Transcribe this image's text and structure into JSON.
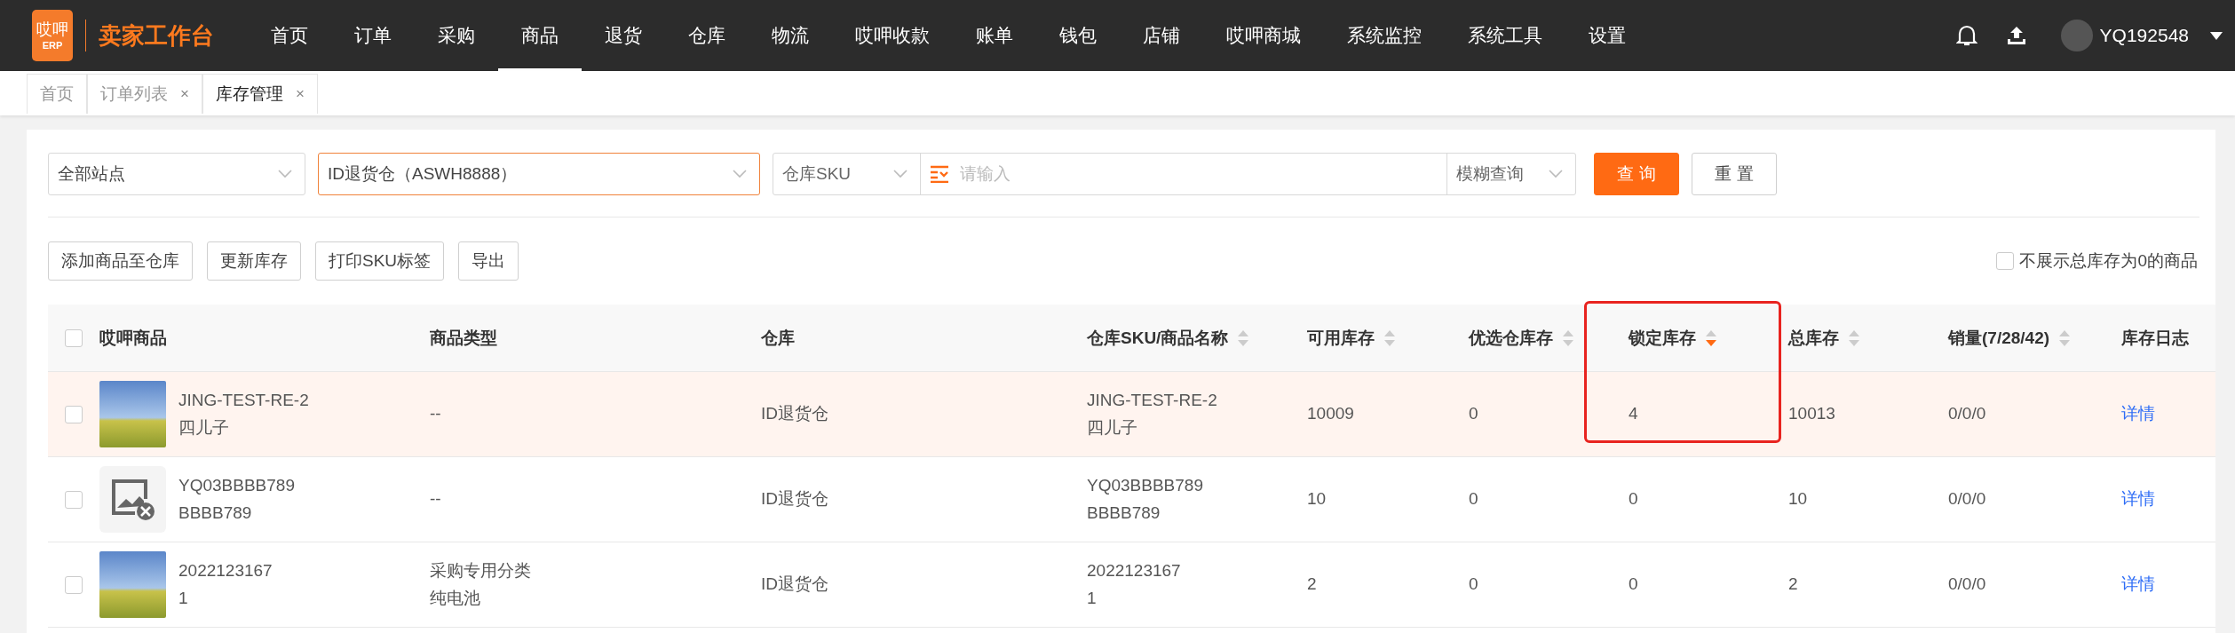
{
  "brand": {
    "logo_top": "哎呷",
    "logo_bottom": "ERP",
    "title": "卖家工作台"
  },
  "nav": [
    {
      "label": "首页",
      "selected": false
    },
    {
      "label": "订单",
      "selected": false
    },
    {
      "label": "采购",
      "selected": false
    },
    {
      "label": "商品",
      "selected": true
    },
    {
      "label": "退货",
      "selected": false
    },
    {
      "label": "仓库",
      "selected": false
    },
    {
      "label": "物流",
      "selected": false
    },
    {
      "label": "哎呷收款",
      "selected": false
    },
    {
      "label": "账单",
      "selected": false
    },
    {
      "label": "钱包",
      "selected": false
    },
    {
      "label": "店铺",
      "selected": false
    },
    {
      "label": "哎呷商城",
      "selected": false
    },
    {
      "label": "系统监控",
      "selected": false
    },
    {
      "label": "系统工具",
      "selected": false
    },
    {
      "label": "设置",
      "selected": false
    }
  ],
  "user": {
    "name": "YQ192548"
  },
  "page_tabs": [
    {
      "label": "首页",
      "selected": false
    },
    {
      "label": "订单列表",
      "selected": false,
      "close_label": "×"
    },
    {
      "label": "库存管理",
      "selected": true,
      "close_label": "×"
    }
  ],
  "filters": {
    "site": {
      "value": "全部站点",
      "focused": false
    },
    "warehouse": {
      "value": "ID退货仓（ASWH8888）",
      "focused": true
    },
    "sku_field": {
      "value": "仓库SKU"
    },
    "keyword": {
      "placeholder": "请输入"
    },
    "match_mode": {
      "value": "模糊查询"
    },
    "buttons": [
      {
        "label": "查 询",
        "kind": "primary"
      },
      {
        "label": "重 置",
        "kind": "default"
      }
    ]
  },
  "actions": [
    "添加商品至仓库",
    "更新库存",
    "打印SKU标签",
    "导出"
  ],
  "hide_zero": {
    "label": "不展示总库存为0的商品",
    "checked": false
  },
  "table": {
    "all_checked": false,
    "columns": [
      {
        "label": "哎呷商品",
        "sortable": false,
        "highlighted": false
      },
      {
        "label": "商品类型",
        "sortable": false,
        "highlighted": false
      },
      {
        "label": "仓库",
        "sortable": false,
        "highlighted": false
      },
      {
        "label": "仓库SKU/商品名称",
        "sortable": true,
        "sorted_desc": false,
        "highlighted": false
      },
      {
        "label": "可用库存",
        "sortable": true,
        "sorted_desc": false,
        "highlighted": false
      },
      {
        "label": "优选仓库存",
        "sortable": true,
        "sorted_desc": false,
        "highlighted": false
      },
      {
        "label": "锁定库存",
        "sortable": true,
        "sorted_desc": true,
        "highlighted": true
      },
      {
        "label": "总库存",
        "sortable": true,
        "sorted_desc": false,
        "highlighted": false
      },
      {
        "label": "销量(7/28/42)",
        "sortable": true,
        "sorted_desc": false,
        "highlighted": false
      },
      {
        "label": "库存日志",
        "sortable": false,
        "highlighted": false
      }
    ],
    "rows": [
      {
        "highlighted": true,
        "checked": false,
        "image": {
          "kind": "photo"
        },
        "product": [
          "JING-TEST-RE-2",
          "四儿子"
        ],
        "type": [
          "--"
        ],
        "warehouse": "ID退货仓",
        "sku": [
          "JING-TEST-RE-2",
          "四儿子"
        ],
        "available": "10009",
        "preferred": "0",
        "locked": "4",
        "total": "10013",
        "sales": "0/0/0",
        "log": "详情"
      },
      {
        "highlighted": false,
        "checked": false,
        "image": {
          "kind": "missing"
        },
        "product": [
          "YQ03BBBB789",
          "BBBB789"
        ],
        "type": [
          "--"
        ],
        "warehouse": "ID退货仓",
        "sku": [
          "YQ03BBBB789",
          "BBBB789"
        ],
        "available": "10",
        "preferred": "0",
        "locked": "0",
        "total": "10",
        "sales": "0/0/0",
        "log": "详情"
      },
      {
        "highlighted": false,
        "checked": false,
        "image": {
          "kind": "photo"
        },
        "product": [
          "2022123167",
          "1"
        ],
        "type": [
          "采购专用分类",
          "纯电池"
        ],
        "warehouse": "ID退货仓",
        "sku": [
          "2022123167",
          "1"
        ],
        "available": "2",
        "preferred": "0",
        "locked": "0",
        "total": "2",
        "sales": "0/0/0",
        "log": "详情"
      }
    ]
  }
}
